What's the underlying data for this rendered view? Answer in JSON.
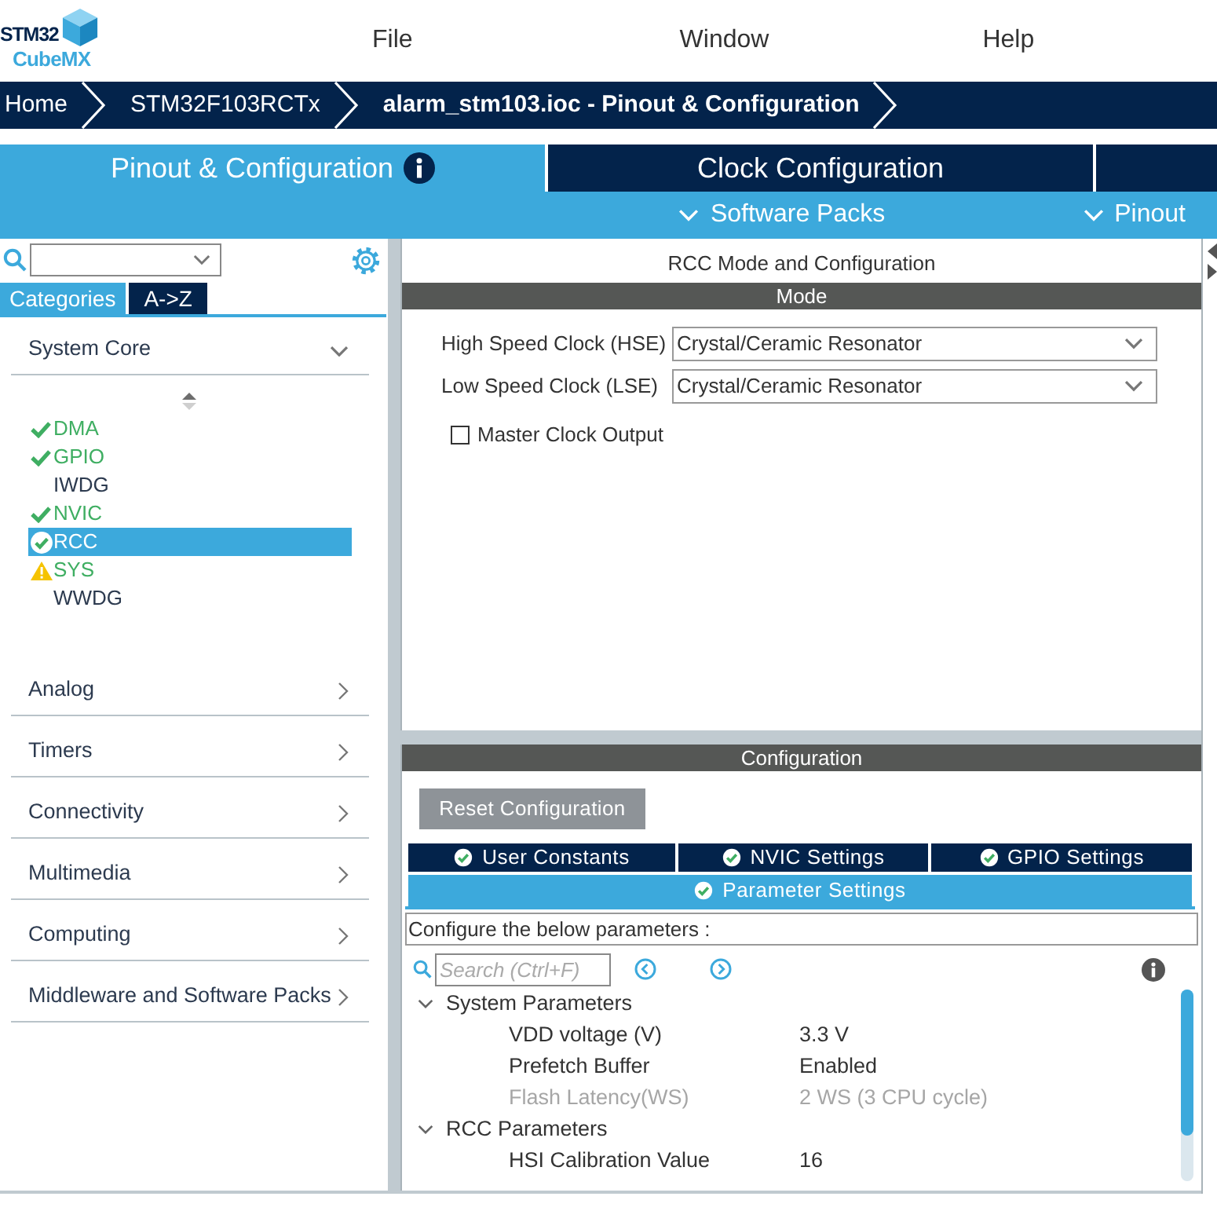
{
  "logo": {
    "line_1": "STM32",
    "line_2": "CubeMX"
  },
  "menu": [
    "File",
    "Window",
    "Help"
  ],
  "breadcrumb": [
    {
      "label": "Home",
      "selected": false
    },
    {
      "label": "STM32F103RCTx",
      "selected": false
    },
    {
      "label": "alarm_stm103.ioc - Pinout & Configuration",
      "selected": true
    }
  ],
  "main_tabs": [
    {
      "label": "Pinout & Configuration",
      "selected": true,
      "info_icon": true
    },
    {
      "label": "Clock Configuration",
      "selected": false
    },
    {
      "selected": false
    }
  ],
  "toolbar": [
    "Software Packs",
    "Pinout"
  ],
  "sidebar": {
    "view_tabs": [
      {
        "label": "Categories",
        "selected": true
      },
      {
        "label": "A->Z",
        "selected": false
      }
    ],
    "categories": [
      {
        "label": "System Core",
        "expanded": true,
        "children": [
          {
            "label": "DMA",
            "configured": true,
            "warning": false,
            "selected": false
          },
          {
            "label": "GPIO",
            "configured": true,
            "warning": false,
            "selected": false
          },
          {
            "label": "IWDG",
            "configured": false,
            "warning": false,
            "selected": false
          },
          {
            "label": "NVIC",
            "configured": true,
            "warning": false,
            "selected": false
          },
          {
            "label": "RCC",
            "configured": true,
            "warning": false,
            "selected": true
          },
          {
            "label": "SYS",
            "configured": true,
            "warning": true,
            "selected": false
          },
          {
            "label": "WWDG",
            "configured": false,
            "warning": false,
            "selected": false
          }
        ]
      },
      {
        "label": "Analog",
        "expanded": false
      },
      {
        "label": "Timers",
        "expanded": false
      },
      {
        "label": "Connectivity",
        "expanded": false
      },
      {
        "label": "Multimedia",
        "expanded": false
      },
      {
        "label": "Computing",
        "expanded": false
      },
      {
        "label": "Middleware and Software Packs",
        "expanded": false
      }
    ]
  },
  "mode_panel": {
    "title": "RCC Mode and Configuration",
    "header": "Mode",
    "fields": [
      {
        "label": "High Speed Clock (HSE)",
        "value": "Crystal/Ceramic Resonator"
      },
      {
        "label": "Low Speed Clock (LSE)",
        "value": "Crystal/Ceramic Resonator"
      }
    ],
    "checkbox": {
      "label": "Master Clock Output",
      "checked": false
    }
  },
  "config_panel": {
    "header": "Configuration",
    "reset_button": "Reset Configuration",
    "tabs": [
      {
        "label": "User Constants",
        "selected": false
      },
      {
        "label": "NVIC Settings",
        "selected": false
      },
      {
        "label": "GPIO Settings",
        "selected": false
      },
      {
        "label": "Parameter Settings",
        "selected": true
      }
    ],
    "hint": "Configure the below parameters :",
    "search": {
      "placeholder": "Search (Ctrl+F)"
    },
    "groups": [
      {
        "label": "System Parameters",
        "expanded": true,
        "children": [
          {
            "name": "VDD voltage (V)",
            "value": "3.3 V",
            "disabled": false
          },
          {
            "name": "Prefetch Buffer",
            "value": "Enabled",
            "disabled": false
          },
          {
            "name": "Flash Latency(WS)",
            "value": "2 WS (3 CPU cycle)",
            "disabled": true
          }
        ]
      },
      {
        "label": "RCC Parameters",
        "expanded": true,
        "children": [
          {
            "name": "HSI Calibration Value",
            "value": "16",
            "disabled": false
          }
        ]
      }
    ]
  }
}
